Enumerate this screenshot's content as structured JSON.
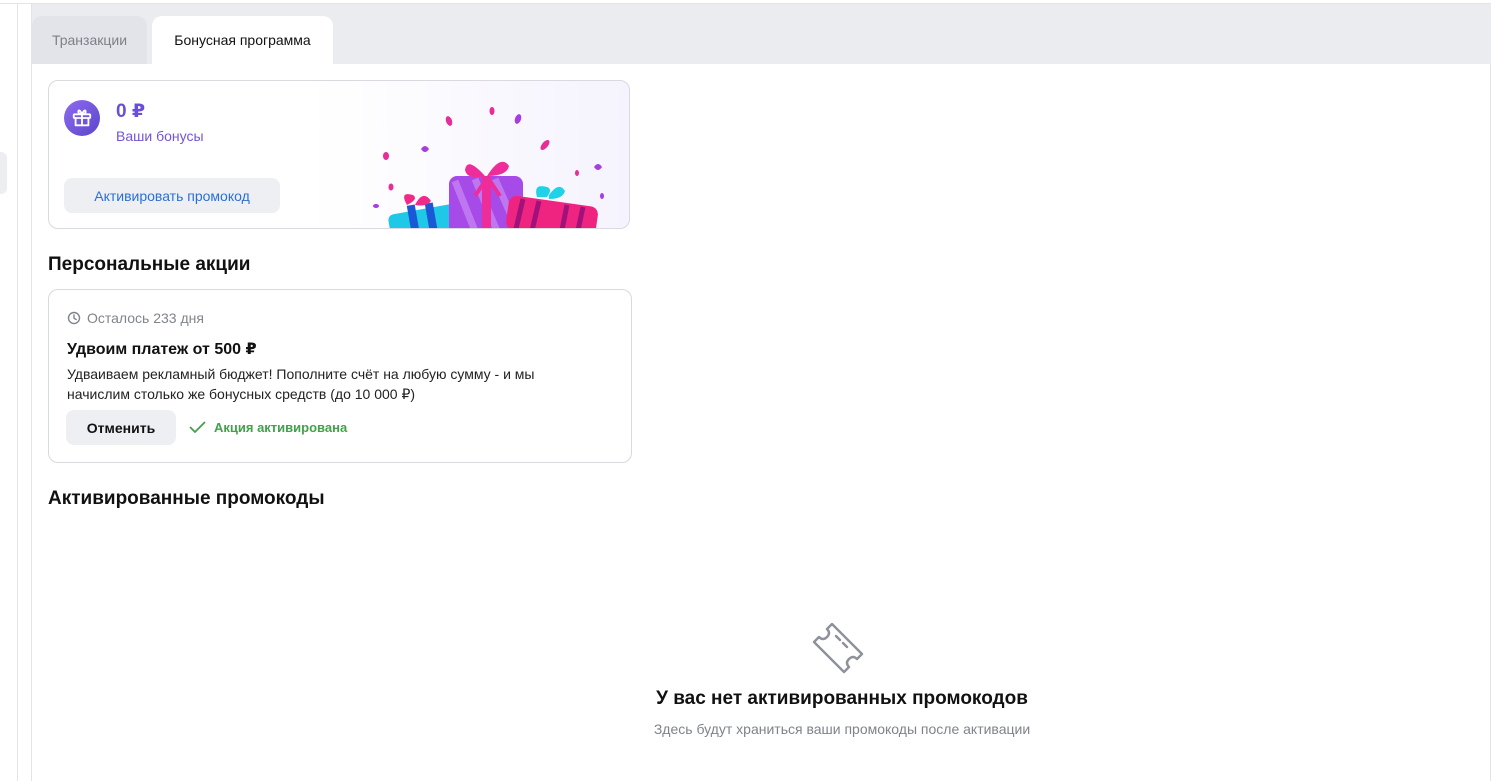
{
  "tabs": [
    {
      "label": "Транзакции",
      "active": false
    },
    {
      "label": "Бонусная программа",
      "active": true
    }
  ],
  "bonus": {
    "amount": "0 ₽",
    "label": "Ваши бонусы",
    "activate_promo_label": "Активировать промокод",
    "icon": "gift-icon"
  },
  "personal": {
    "heading": "Персональные акции",
    "promo": {
      "remaining": "Осталось 233 дня",
      "title": "Удвоим платеж от 500 ₽",
      "description": "Удваиваем рекламный бюджет! Пополните счёт на любую сумму - и мы начислим столько же бонусных средств (до 10 000 ₽)",
      "cancel_label": "Отменить",
      "status_label": "Акция активирована",
      "status_color": "#43a04b"
    }
  },
  "activated": {
    "heading": "Активированные промокоды",
    "empty_title": "У вас нет активированных промокодов",
    "empty_subtitle": "Здесь будут храниться ваши промокоды после активации",
    "icon": "ticket-icon"
  },
  "colors": {
    "accent_purple": "#6a4fd6",
    "link_blue": "#2b6fd6"
  }
}
